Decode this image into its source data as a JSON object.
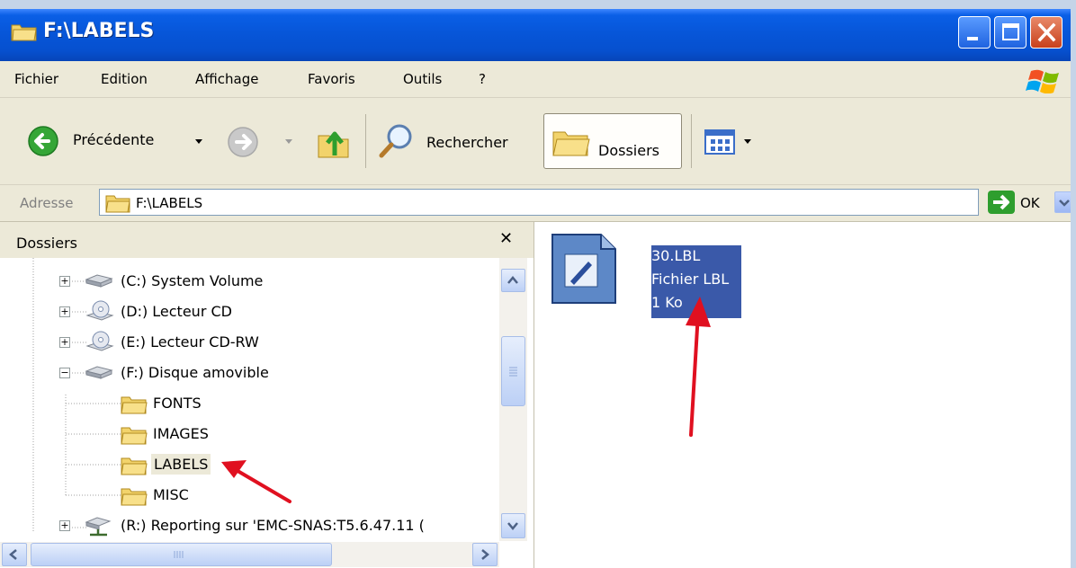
{
  "window": {
    "title": "F:\\LABELS"
  },
  "menu": [
    "Fichier",
    "Edition",
    "Affichage",
    "Favoris",
    "Outils",
    "?"
  ],
  "toolbar": {
    "back_label": "Précédente",
    "search_label": "Rechercher",
    "folders_label": "Dossiers"
  },
  "address": {
    "label": "Adresse",
    "value": "F:\\LABELS",
    "go_label": "OK"
  },
  "folders_pane": {
    "title": "Dossiers",
    "items": [
      {
        "label": "(C:) System Volume",
        "expander": "+"
      },
      {
        "label": "(D:) Lecteur CD",
        "expander": "+"
      },
      {
        "label": "(E:) Lecteur CD-RW",
        "expander": "+"
      },
      {
        "label": "(F:) Disque amovible",
        "expander": "−"
      },
      {
        "label": "FONTS"
      },
      {
        "label": "IMAGES"
      },
      {
        "label": "LABELS"
      },
      {
        "label": "MISC"
      },
      {
        "label": "(R:) Reporting sur 'EMC-SNAS:T5.6.47.11 (",
        "expander": "+"
      }
    ]
  },
  "file": {
    "name": "30.LBL",
    "type": "Fichier LBL",
    "size": "1 Ko"
  },
  "colors": {
    "titlebar": "#0756d9",
    "selection": "#3a59a9",
    "annotation_arrow": "#e01020"
  }
}
